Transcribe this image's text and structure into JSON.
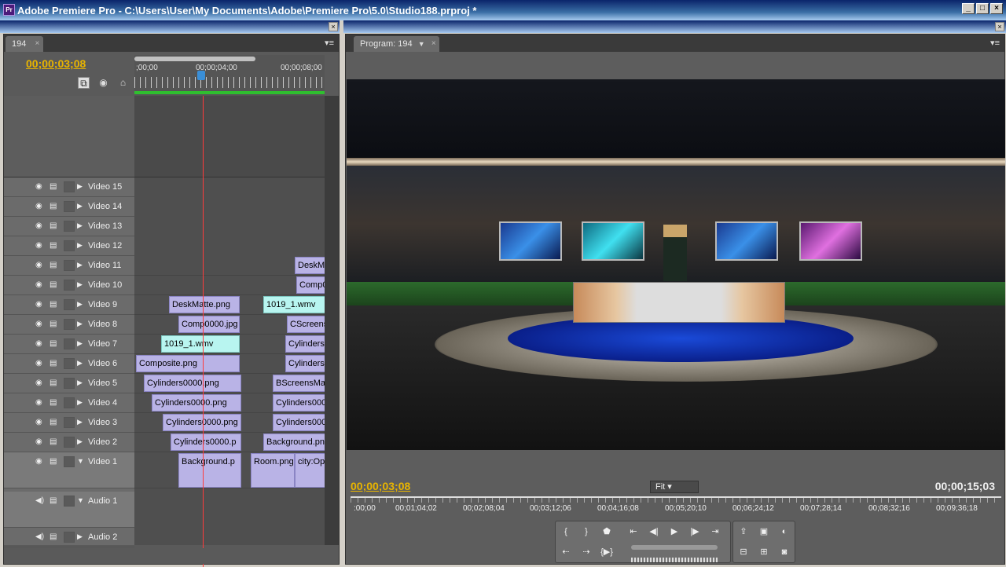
{
  "window": {
    "title": "Adobe Premiere Pro - C:\\Users\\User\\My Documents\\Adobe\\Premiere Pro\\5.0\\Studio188.prproj *",
    "app_icon": "Pr",
    "min": "_",
    "max": "□",
    "close": "×"
  },
  "timeline": {
    "tab": "194",
    "current_time": "00;00;03;08",
    "ruler": [
      ";00;00",
      "00;00;04;00",
      "00;00;08;00"
    ],
    "tracks": [
      {
        "name": "Video 15"
      },
      {
        "name": "Video 14"
      },
      {
        "name": "Video 13"
      },
      {
        "name": "Video 12"
      },
      {
        "name": "Video 11"
      },
      {
        "name": "Video 10"
      },
      {
        "name": "Video 9"
      },
      {
        "name": "Video 8"
      },
      {
        "name": "Video 7"
      },
      {
        "name": "Video 6"
      },
      {
        "name": "Video 5"
      },
      {
        "name": "Video 4"
      },
      {
        "name": "Video 3"
      },
      {
        "name": "Video 2"
      },
      {
        "name": "Video 1"
      },
      {
        "name": "Audio 1"
      },
      {
        "name": "Audio 2"
      }
    ],
    "clips": {
      "v11": "DeskM",
      "v10": "Comp0",
      "v9a": "DeskMatte.png",
      "v9b": "1019_1.wmv",
      "v8a": "Comp0000.jpg",
      "v8b": "CScreens",
      "v7a": "1019_1.wmv",
      "v7b": "Cylinders",
      "v6a": "Composite.png",
      "v6b": "Cylinders",
      "v5a": "Cylinders0000.png",
      "v5b": "BScreensMat",
      "v4a": "Cylinders0000.png",
      "v4b": "Cylinders000",
      "v3a": "Cylinders0000.png",
      "v3b": "Cylinders000",
      "v2a": "Cylinders0000.p",
      "v2b": "Background.pn",
      "v1a": "Background.p",
      "v1b": "Room.png",
      "v1c": "city:Op"
    }
  },
  "program": {
    "tab": "Program: 194",
    "current_time": "00;00;03;08",
    "duration": "00;00;15;03",
    "fit": "Fit",
    "ruler": [
      ":00;00",
      "00;01;04;02",
      "00;02;08;04",
      "00;03;12;06",
      "00;04;16;08",
      "00;05;20;10",
      "00;06;24;12",
      "00;07;28;14",
      "00;08;32;16",
      "00;09;36;18"
    ]
  }
}
